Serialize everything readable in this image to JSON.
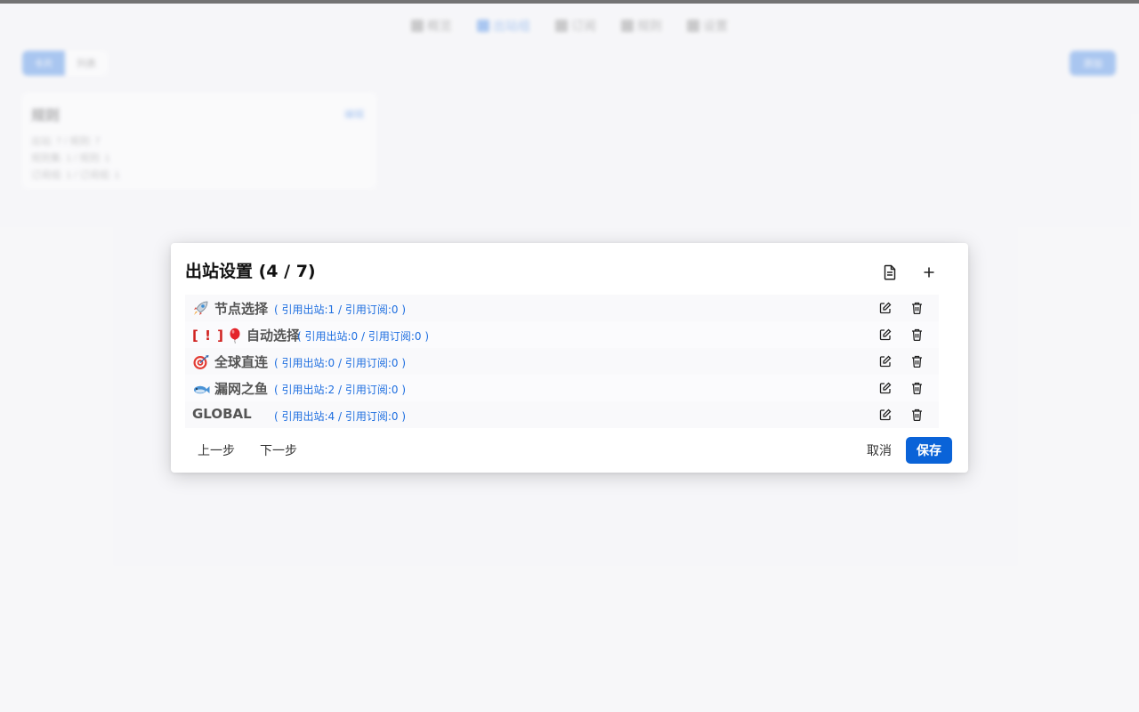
{
  "background": {
    "nav": [
      {
        "label": "概览",
        "active": false
      },
      {
        "label": "出站组",
        "active": true
      },
      {
        "label": "订阅",
        "active": false
      },
      {
        "label": "规则",
        "active": false
      },
      {
        "label": "设置",
        "active": false
      }
    ],
    "segment": [
      "卡片",
      "列表"
    ],
    "add_label": "添加",
    "card": {
      "title": "规则",
      "tag": "编辑",
      "lines": [
        "出站: 7 / 规则: 7",
        "规则集: 1 / 规则: 1",
        "订阅组: 1 / 订阅组: 1"
      ]
    }
  },
  "modal": {
    "title": "出站设置 (4 / 7)",
    "rows": [
      {
        "name": "节点选择",
        "ref": "( 引用出站:1 / 引用订阅:0 )",
        "emoji": "rocket"
      },
      {
        "name": "自动选择",
        "prefix": "[ ! ]",
        "ref": "( 引用出站:0 / 引用订阅:0 )",
        "emoji": "balloon"
      },
      {
        "name": "全球直连",
        "ref": "( 引用出站:0 / 引用订阅:0 )",
        "emoji": "target"
      },
      {
        "name": "漏网之鱼",
        "ref": "( 引用出站:2 / 引用订阅:0 )",
        "emoji": "fish"
      },
      {
        "name": "GLOBAL",
        "ref": "( 引用出站:4 / 引用订阅:0 )",
        "emoji": ""
      }
    ],
    "footer": {
      "prev": "上一步",
      "next": "下一步",
      "cancel": "取消",
      "save": "保存"
    }
  },
  "colors": {
    "accent": "#0a63d8",
    "ref_text": "#1f6fe0",
    "bang": "#d0201e"
  },
  "icons": [
    "file-icon",
    "plus-icon",
    "edit-icon",
    "trash-icon"
  ]
}
